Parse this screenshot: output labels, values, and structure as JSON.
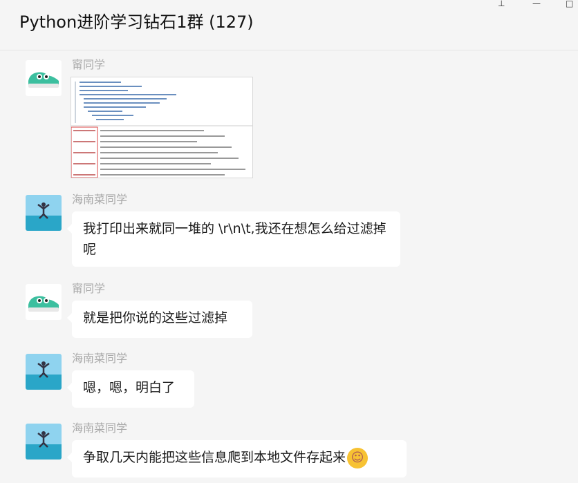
{
  "window": {
    "title": "Python进阶学习钻石1群 (127)",
    "pin_glyph": "⊥",
    "minimize_glyph": "—",
    "maximize_glyph": "□"
  },
  "messages": [
    {
      "sender": "甯同学",
      "avatar": "shoe-avatar-icon",
      "type": "image"
    },
    {
      "sender": "海南菜同学",
      "avatar": "jumping-person-avatar-icon",
      "text": "我打印出来就同一堆的 \\r\\n\\t,我还在想怎么给过滤掉呢"
    },
    {
      "sender": "甯同学",
      "avatar": "shoe-avatar-icon",
      "text": "就是把你说的这些过滤掉"
    },
    {
      "sender": "海南菜同学",
      "avatar": "jumping-person-avatar-icon",
      "text": "嗯，嗯，明白了"
    },
    {
      "sender": "海南菜同学",
      "avatar": "jumping-person-avatar-icon",
      "text": "争取几天内能把这些信息爬到本地文件存起来",
      "emoji": "laughing-crying-emoji-icon"
    }
  ],
  "colors": {
    "background": "#f5f5f5",
    "bubble": "#ffffff",
    "sender_name": "#a9a9a9"
  }
}
